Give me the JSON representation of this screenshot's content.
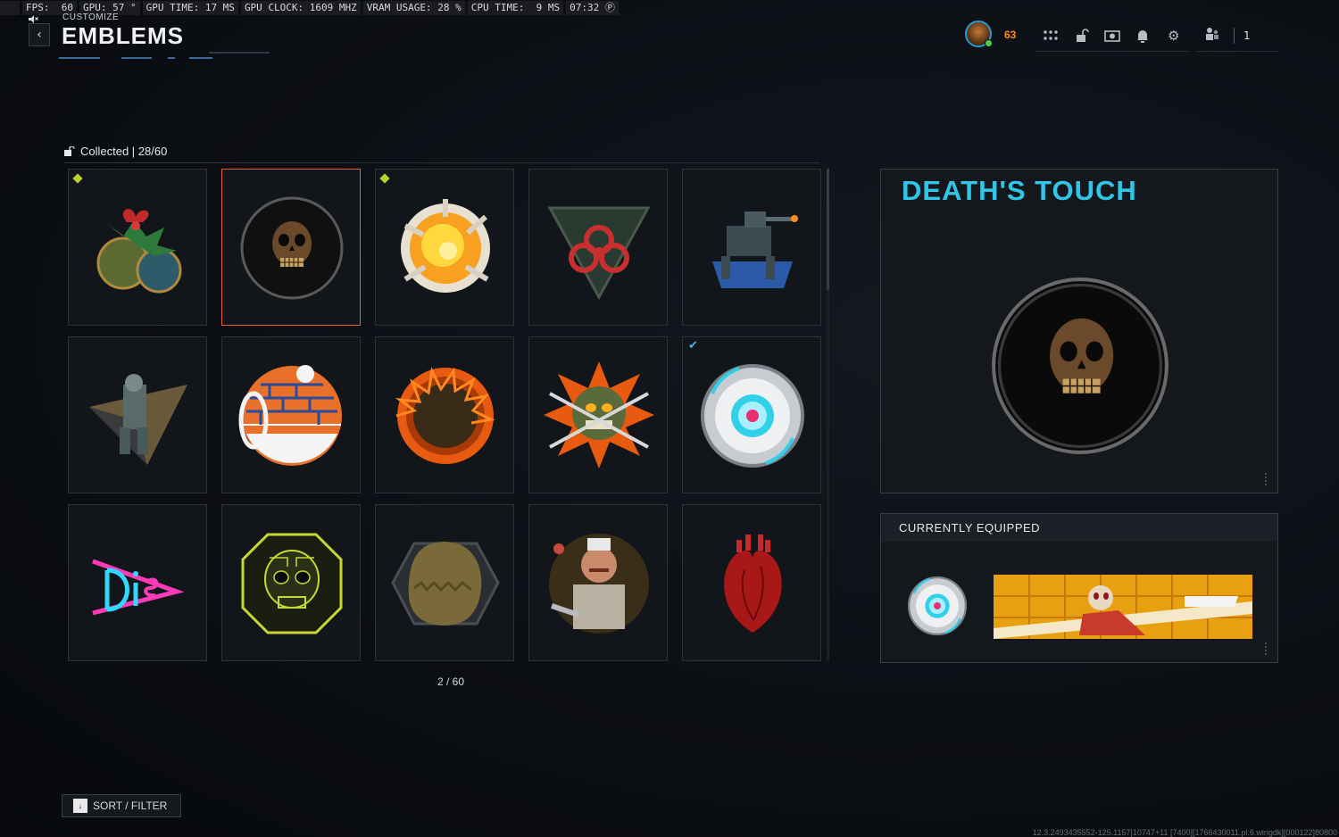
{
  "perf": {
    "mute_icon": "speaker-mute-icon",
    "segments": [
      "FPS:  60",
      "GPU: 57 °",
      "GPU TIME: 17 MS",
      "GPU CLOCK: 1609 MHZ",
      "VRAM USAGE: 28 %",
      "CPU TIME:  9 MS",
      "07:32 Ⓟ"
    ]
  },
  "header": {
    "breadcrumb": "CUSTOMIZE",
    "title": "EMBLEMS",
    "back_icon": "chevron-left-icon"
  },
  "topbar": {
    "level": "63",
    "icons": [
      "grid-menu-icon",
      "lock-icon",
      "camera-icon",
      "bell-icon",
      "gear-icon"
    ],
    "squad_icon": "party-icon",
    "squad_count": "1"
  },
  "collection": {
    "label": "Collected | 28/60",
    "page_indicator": "2 / 60"
  },
  "tiles": [
    {
      "name": "ornaments",
      "badge": "new"
    },
    {
      "name": "deaths-touch-skull",
      "selected": true
    },
    {
      "name": "explosion-burst",
      "badge": "new"
    },
    {
      "name": "biohazard"
    },
    {
      "name": "mech-walker"
    },
    {
      "name": "soldier-triangle"
    },
    {
      "name": "brick-sphere"
    },
    {
      "name": "scorch-mark"
    },
    {
      "name": "demon-burst"
    },
    {
      "name": "cyber-eye",
      "equipped": true
    },
    {
      "name": "neon-die"
    },
    {
      "name": "circuit-skull"
    },
    {
      "name": "furry-beast"
    },
    {
      "name": "butcher"
    },
    {
      "name": "anatomical-heart"
    }
  ],
  "detail": {
    "title": "DEATH'S TOUCH"
  },
  "equipped": {
    "heading": "CURRENTLY EQUIPPED"
  },
  "footer": {
    "sort_key": "↓",
    "sort_label": "SORT / FILTER",
    "build_string": "12.3.2493435552-125.1157|10747+11 [7400][1766430011.pl.6.wingdk][000122]80800"
  },
  "colors": {
    "accent_cyan": "#2fc6e8",
    "selected_border": "#e0622a",
    "level_orange": "#ff8a1c",
    "new_badge": "#b8d030"
  }
}
